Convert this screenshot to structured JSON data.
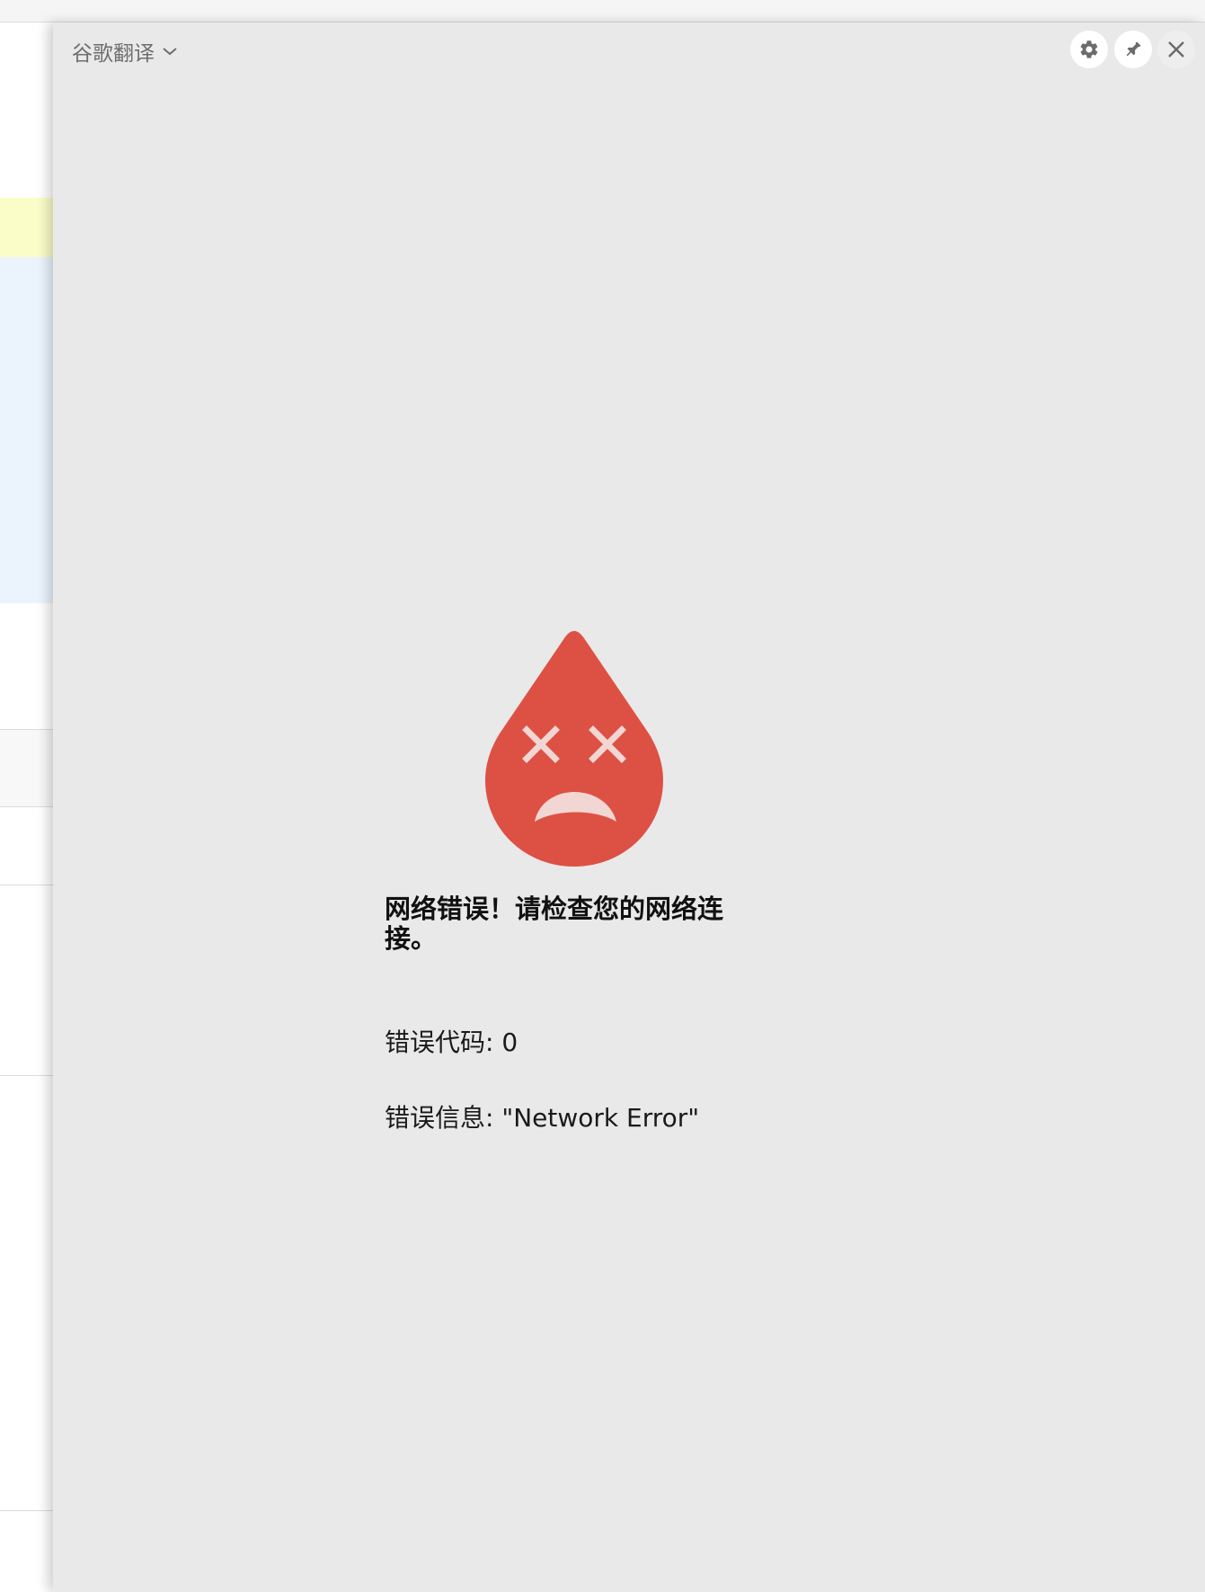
{
  "panel": {
    "engine_label": "谷歌翻译",
    "background_color": "#eae9ea",
    "toolbar": {
      "settings_icon": "gear-icon",
      "pin_icon": "pin-icon",
      "close_icon": "close-icon"
    }
  },
  "error": {
    "icon": "sad-drop-icon",
    "icon_color": "#dd5144",
    "title": "网络错误！请检查您的网络连接。",
    "code_label": "错误代码",
    "code_value": "0",
    "code_line": "错误代码: 0",
    "message_label": "错误信息",
    "message_value": "\"Network Error\"",
    "message_line": "错误信息: \"Network Error\""
  }
}
